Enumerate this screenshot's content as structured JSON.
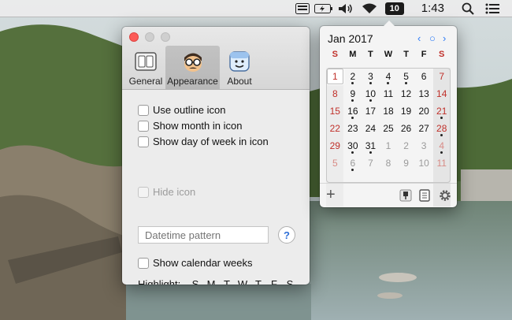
{
  "menubar": {
    "date_badge": "10",
    "time": "1:43",
    "icons": [
      "input-source-icon",
      "battery-charging-icon",
      "volume-icon",
      "wifi-icon",
      "date-badge",
      "spotlight-icon",
      "notification-center-icon"
    ]
  },
  "prefs": {
    "tabs": [
      {
        "label": "General",
        "icon": "general-icon"
      },
      {
        "label": "Appearance",
        "icon": "appearance-icon",
        "selected": true
      },
      {
        "label": "About",
        "icon": "about-icon"
      }
    ],
    "options": {
      "outline_icon": {
        "label": "Use outline icon",
        "checked": false
      },
      "month_in_icon": {
        "label": "Show month in icon",
        "checked": false
      },
      "dow_in_icon": {
        "label": "Show day of week in icon",
        "checked": false
      },
      "hide_icon": {
        "label": "Hide icon",
        "checked": false,
        "disabled": true
      },
      "calendar_weeks": {
        "label": "Show calendar weeks",
        "checked": false
      }
    },
    "datetime_placeholder": "Datetime pattern",
    "help_label": "?",
    "highlight": {
      "label": "Highlight:",
      "days": [
        {
          "letter": "S",
          "checked": true
        },
        {
          "letter": "M",
          "checked": false
        },
        {
          "letter": "T",
          "checked": false
        },
        {
          "letter": "W",
          "checked": false
        },
        {
          "letter": "T",
          "checked": false
        },
        {
          "letter": "F",
          "checked": false
        },
        {
          "letter": "S",
          "checked": true
        }
      ]
    },
    "accent_color": "#2f7df6"
  },
  "calendar": {
    "title": "Jan 2017",
    "prev": "‹",
    "today_btn": "○",
    "next": "›",
    "weekdays": [
      "S",
      "M",
      "T",
      "W",
      "T",
      "F",
      "S"
    ],
    "weeks": [
      [
        {
          "d": "1",
          "today": true
        },
        {
          "d": "2",
          "dot": true
        },
        {
          "d": "3",
          "dot": true
        },
        {
          "d": "4",
          "dot": true
        },
        {
          "d": "5",
          "dot": true
        },
        {
          "d": "6"
        },
        {
          "d": "7"
        }
      ],
      [
        {
          "d": "8"
        },
        {
          "d": "9",
          "dot": true
        },
        {
          "d": "10",
          "dot": true
        },
        {
          "d": "11"
        },
        {
          "d": "12"
        },
        {
          "d": "13"
        },
        {
          "d": "14"
        }
      ],
      [
        {
          "d": "15"
        },
        {
          "d": "16",
          "dot": true
        },
        {
          "d": "17"
        },
        {
          "d": "18"
        },
        {
          "d": "19"
        },
        {
          "d": "20"
        },
        {
          "d": "21",
          "dot": true
        }
      ],
      [
        {
          "d": "22"
        },
        {
          "d": "23"
        },
        {
          "d": "24"
        },
        {
          "d": "25"
        },
        {
          "d": "26"
        },
        {
          "d": "27"
        },
        {
          "d": "28",
          "dot": true
        }
      ],
      [
        {
          "d": "29"
        },
        {
          "d": "30",
          "dot": true
        },
        {
          "d": "31",
          "dot": true
        },
        {
          "d": "1",
          "other": true
        },
        {
          "d": "2",
          "other": true
        },
        {
          "d": "3",
          "other": true
        },
        {
          "d": "4",
          "other": true,
          "dot": true
        }
      ],
      [
        {
          "d": "5",
          "other": true
        },
        {
          "d": "6",
          "other": true,
          "dot": true
        },
        {
          "d": "7",
          "other": true
        },
        {
          "d": "8",
          "other": true
        },
        {
          "d": "9",
          "other": true
        },
        {
          "d": "10",
          "other": true
        },
        {
          "d": "11",
          "other": true
        }
      ]
    ],
    "footer": {
      "add": "+",
      "icons": [
        "pin-icon",
        "notes-icon",
        "gear-icon"
      ]
    },
    "weekend_color": "#c0302a"
  }
}
